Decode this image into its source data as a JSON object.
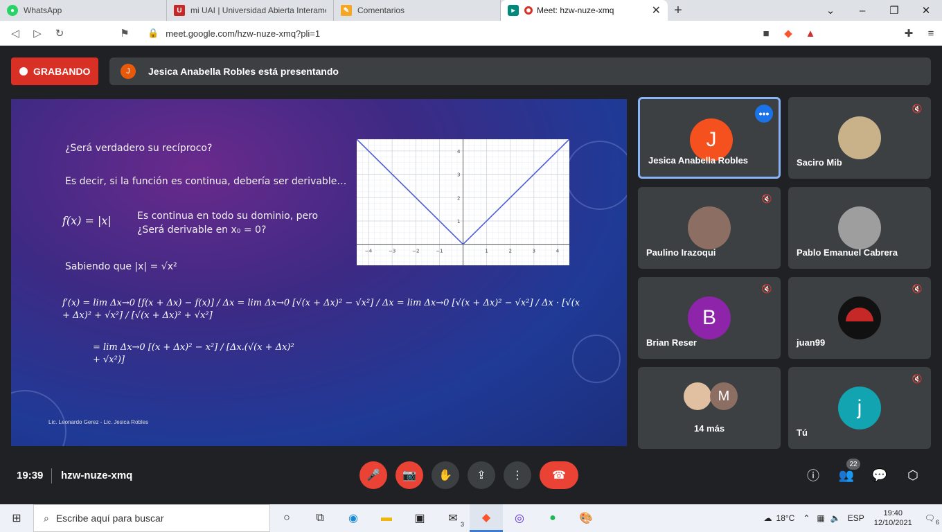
{
  "browser": {
    "tabs": [
      {
        "label": "WhatsApp",
        "icon": "whatsapp-icon",
        "color": "#25d366"
      },
      {
        "label": "mi UAI | Universidad Abierta Interame",
        "icon": "uai-icon",
        "color": "#c62828"
      },
      {
        "label": "Comentarios",
        "icon": "notes-icon",
        "color": "#f5a623"
      },
      {
        "label": "Meet: hzw-nuze-xmq",
        "icon": "meet-icon",
        "color": "#00897b"
      }
    ],
    "url": "meet.google.com/hzw-nuze-xmq?pli=1"
  },
  "meet": {
    "recording_label": "GRABANDO",
    "presenter_initial": "J",
    "presenting_text": "Jesica Anabella Robles está presentando",
    "time": "19:39",
    "meeting_code": "hzw-nuze-xmq",
    "people_count": "22",
    "participants": [
      {
        "name": "Jesica Anabella Robles",
        "initial": "J",
        "avatar_color": "#f4511e"
      },
      {
        "name": "Saciro Mib",
        "initial": "",
        "avatar_color": "#c9b28a"
      },
      {
        "name": "Paulino Irazoqui",
        "initial": "",
        "avatar_color": "#8d6e63"
      },
      {
        "name": "Pablo Emanuel Cabrera",
        "initial": "",
        "avatar_color": "#9e9e9e"
      },
      {
        "name": "Brian Reser",
        "initial": "B",
        "avatar_color": "#8e24aa"
      },
      {
        "name": "juan99",
        "initial": "",
        "avatar_color": "#111111"
      },
      {
        "name": "14 más",
        "initial": "M",
        "avatar_color": "#8d6e63"
      },
      {
        "name": "Tú",
        "initial": "j",
        "avatar_color": "#12a4b0"
      }
    ]
  },
  "slide": {
    "line1": "¿Será verdadero su recíproco?",
    "line2": "Es decir, si la función es continua, debería ser derivable…",
    "func": "f(x) = |x|",
    "line3a": "Es continua en todo su dominio, pero",
    "line3b": "¿Será derivable en x₀ = 0?",
    "line4": "Sabiendo que |x| = √x²",
    "eq1": "f′(x) = lim Δx→0 [f(x + Δx) − f(x)] / Δx = lim Δx→0 [√(x + Δx)² − √x²] / Δx = lim Δx→0 [√(x + Δx)² − √x²] / Δx · [√(x + Δx)² + √x²] / [√(x + Δx)² + √x²]",
    "eq2": "= lim Δx→0 [(x + Δx)² − x²] / [Δx.(√(x + Δx)² + √x²)]",
    "credit": "Lic. Leonardo Gerez - Lic. Jesica Robles"
  },
  "chart_data": {
    "type": "line",
    "title": "",
    "xlabel": "",
    "ylabel": "",
    "x": [
      -4.5,
      0,
      4.5
    ],
    "series": [
      {
        "values": [
          4.5,
          0,
          4.5
        ]
      }
    ],
    "xlim": [
      -4.5,
      4.5
    ],
    "ylim": [
      -0.9,
      4.5
    ],
    "xticks": [
      -4,
      -3,
      -2,
      -1,
      1,
      2,
      3,
      4
    ],
    "yticks": [
      1,
      2,
      3,
      4
    ],
    "grid": true,
    "color": "#4a5bd6"
  },
  "taskbar": {
    "search_placeholder": "Escribe aquí para buscar",
    "mail_badge": "3",
    "temperature": "18°C",
    "lang": "ESP",
    "clock_time": "19:40",
    "clock_date": "12/10/2021",
    "notif_count": "6"
  }
}
